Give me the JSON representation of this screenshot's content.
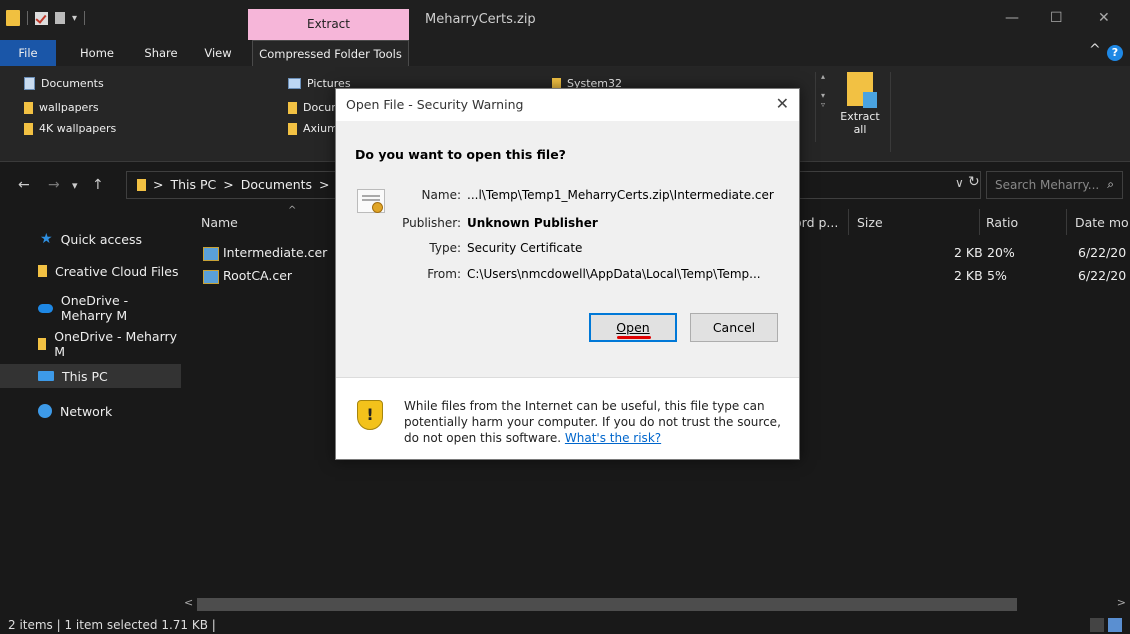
{
  "titlebar": {
    "context_tab": "Extract",
    "window_title": "MeharryCerts.zip",
    "min_icon": "—",
    "max_icon": "☐",
    "close_icon": "✕",
    "quick_access_down": "▾"
  },
  "ribbon_tabs": {
    "file": "File",
    "home": "Home",
    "share": "Share",
    "view": "View",
    "compressed": "Compressed Folder Tools",
    "collapse": "^",
    "help": "?"
  },
  "ribbon": {
    "items": [
      "Documents",
      "wallpapers",
      "4K wallpapers",
      "Pictures",
      "Docur",
      "Axium",
      "System32"
    ],
    "extract_all_1": "Extract",
    "extract_all_2": "all",
    "scroll_up": "▴",
    "scroll_down": "▾",
    "scroll_more": "▿"
  },
  "address": {
    "back": "←",
    "forward": "→",
    "recent": "▾",
    "up": "↑",
    "crumb_sep": ">",
    "crumbs": [
      "This PC",
      "Documents",
      "Dc"
    ],
    "dropdown": "∨",
    "refresh": "↻",
    "search_placeholder": "Search Meharry...",
    "search_glyph": "⌕"
  },
  "navpane": {
    "quick_access": "Quick access",
    "creative_cloud": "Creative Cloud Files",
    "onedrive1": "OneDrive - Meharry M",
    "onedrive2": "OneDrive - Meharry M",
    "this_pc": "This PC",
    "network": "Network"
  },
  "list": {
    "columns": {
      "name": "Name",
      "sort": "^",
      "pwd": "ord p...",
      "size": "Size",
      "ratio": "Ratio",
      "date": "Date mo"
    },
    "rows": [
      {
        "name": "Intermediate.cer",
        "size": "2 KB",
        "ratio": "20%",
        "date": "6/22/20"
      },
      {
        "name": "RootCA.cer",
        "size": "2 KB",
        "ratio": "5%",
        "date": "6/22/20"
      }
    ],
    "scroll_left": "<",
    "scroll_right": ">"
  },
  "status": {
    "text": "2 items  |  1 item selected  1.71 KB  |"
  },
  "dialog": {
    "title": "Open File - Security Warning",
    "close": "✕",
    "question": "Do you want to open this file?",
    "name_label": "Name:",
    "name_value": "...l\\Temp\\Temp1_MeharryCerts.zip\\Intermediate.cer",
    "publisher_label": "Publisher:",
    "publisher_value": "Unknown Publisher",
    "type_label": "Type:",
    "type_value": "Security Certificate",
    "from_label": "From:",
    "from_value": "C:\\Users\\nmcdowell\\AppData\\Local\\Temp\\Temp...",
    "open_label": "Open",
    "cancel_label": "Cancel",
    "warning_text": "While files from the Internet can be useful, this file type can potentially harm your computer. If you do not trust the source, do not open this software.",
    "risk_link": "What's the risk?",
    "shield_glyph": "!"
  }
}
